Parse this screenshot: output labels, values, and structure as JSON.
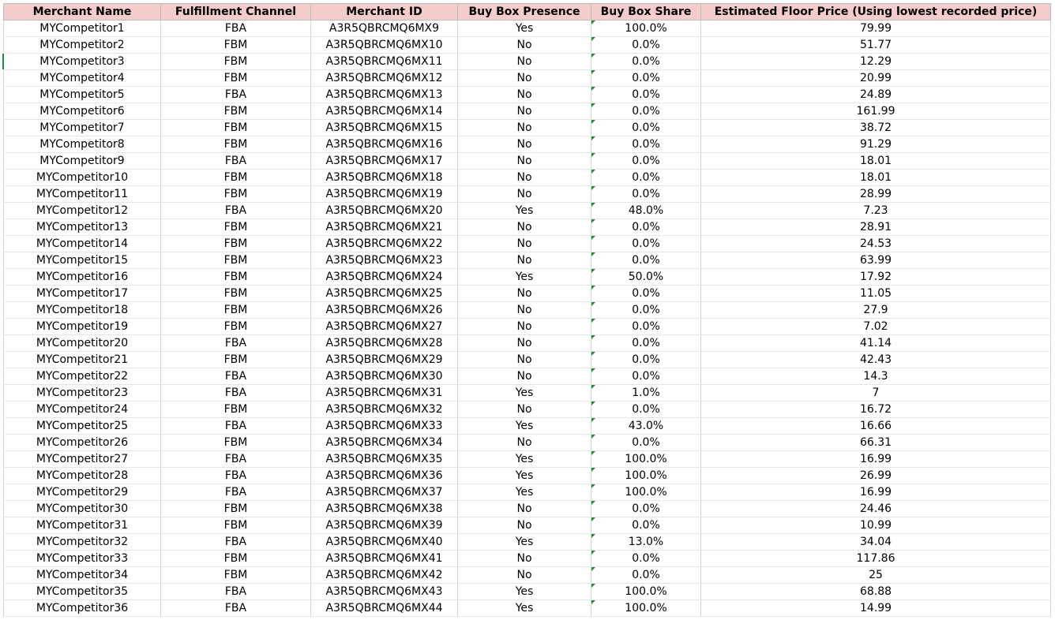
{
  "sheet": {
    "columns": [
      "Merchant Name",
      "Fulfillment Channel",
      "Merchant ID",
      "Buy Box Presence",
      "Buy Box Share",
      "Estimated Floor Price (Using lowest recorded price)"
    ],
    "colors": {
      "header_bg": "#f4cccc",
      "text_note_marker": "#1e8e3e"
    },
    "rows": [
      [
        "MYCompetitor1",
        "FBA",
        "A3R5QBRCMQ6MX9",
        "Yes",
        "100.0%",
        "79.99"
      ],
      [
        "MYCompetitor2",
        "FBM",
        "A3R5QBRCMQ6MX10",
        "No",
        "0.0%",
        "51.77"
      ],
      [
        "MYCompetitor3",
        "FBM",
        "A3R5QBRCMQ6MX11",
        "No",
        "0.0%",
        "12.29"
      ],
      [
        "MYCompetitor4",
        "FBM",
        "A3R5QBRCMQ6MX12",
        "No",
        "0.0%",
        "20.99"
      ],
      [
        "MYCompetitor5",
        "FBA",
        "A3R5QBRCMQ6MX13",
        "No",
        "0.0%",
        "24.89"
      ],
      [
        "MYCompetitor6",
        "FBM",
        "A3R5QBRCMQ6MX14",
        "No",
        "0.0%",
        "161.99"
      ],
      [
        "MYCompetitor7",
        "FBM",
        "A3R5QBRCMQ6MX15",
        "No",
        "0.0%",
        "38.72"
      ],
      [
        "MYCompetitor8",
        "FBM",
        "A3R5QBRCMQ6MX16",
        "No",
        "0.0%",
        "91.29"
      ],
      [
        "MYCompetitor9",
        "FBA",
        "A3R5QBRCMQ6MX17",
        "No",
        "0.0%",
        "18.01"
      ],
      [
        "MYCompetitor10",
        "FBM",
        "A3R5QBRCMQ6MX18",
        "No",
        "0.0%",
        "18.01"
      ],
      [
        "MYCompetitor11",
        "FBM",
        "A3R5QBRCMQ6MX19",
        "No",
        "0.0%",
        "28.99"
      ],
      [
        "MYCompetitor12",
        "FBA",
        "A3R5QBRCMQ6MX20",
        "Yes",
        "48.0%",
        "7.23"
      ],
      [
        "MYCompetitor13",
        "FBM",
        "A3R5QBRCMQ6MX21",
        "No",
        "0.0%",
        "28.91"
      ],
      [
        "MYCompetitor14",
        "FBM",
        "A3R5QBRCMQ6MX22",
        "No",
        "0.0%",
        "24.53"
      ],
      [
        "MYCompetitor15",
        "FBM",
        "A3R5QBRCMQ6MX23",
        "No",
        "0.0%",
        "63.99"
      ],
      [
        "MYCompetitor16",
        "FBM",
        "A3R5QBRCMQ6MX24",
        "Yes",
        "50.0%",
        "17.92"
      ],
      [
        "MYCompetitor17",
        "FBM",
        "A3R5QBRCMQ6MX25",
        "No",
        "0.0%",
        "11.05"
      ],
      [
        "MYCompetitor18",
        "FBM",
        "A3R5QBRCMQ6MX26",
        "No",
        "0.0%",
        "27.9"
      ],
      [
        "MYCompetitor19",
        "FBM",
        "A3R5QBRCMQ6MX27",
        "No",
        "0.0%",
        "7.02"
      ],
      [
        "MYCompetitor20",
        "FBA",
        "A3R5QBRCMQ6MX28",
        "No",
        "0.0%",
        "41.14"
      ],
      [
        "MYCompetitor21",
        "FBM",
        "A3R5QBRCMQ6MX29",
        "No",
        "0.0%",
        "42.43"
      ],
      [
        "MYCompetitor22",
        "FBA",
        "A3R5QBRCMQ6MX30",
        "No",
        "0.0%",
        "14.3"
      ],
      [
        "MYCompetitor23",
        "FBA",
        "A3R5QBRCMQ6MX31",
        "Yes",
        "1.0%",
        "7"
      ],
      [
        "MYCompetitor24",
        "FBM",
        "A3R5QBRCMQ6MX32",
        "No",
        "0.0%",
        "16.72"
      ],
      [
        "MYCompetitor25",
        "FBA",
        "A3R5QBRCMQ6MX33",
        "Yes",
        "43.0%",
        "16.66"
      ],
      [
        "MYCompetitor26",
        "FBM",
        "A3R5QBRCMQ6MX34",
        "No",
        "0.0%",
        "66.31"
      ],
      [
        "MYCompetitor27",
        "FBA",
        "A3R5QBRCMQ6MX35",
        "Yes",
        "100.0%",
        "16.99"
      ],
      [
        "MYCompetitor28",
        "FBA",
        "A3R5QBRCMQ6MX36",
        "Yes",
        "100.0%",
        "26.99"
      ],
      [
        "MYCompetitor29",
        "FBA",
        "A3R5QBRCMQ6MX37",
        "Yes",
        "100.0%",
        "16.99"
      ],
      [
        "MYCompetitor30",
        "FBM",
        "A3R5QBRCMQ6MX38",
        "No",
        "0.0%",
        "24.46"
      ],
      [
        "MYCompetitor31",
        "FBM",
        "A3R5QBRCMQ6MX39",
        "No",
        "0.0%",
        "10.99"
      ],
      [
        "MYCompetitor32",
        "FBA",
        "A3R5QBRCMQ6MX40",
        "Yes",
        "13.0%",
        "34.04"
      ],
      [
        "MYCompetitor33",
        "FBM",
        "A3R5QBRCMQ6MX41",
        "No",
        "0.0%",
        "117.86"
      ],
      [
        "MYCompetitor34",
        "FBM",
        "A3R5QBRCMQ6MX42",
        "No",
        "0.0%",
        "25"
      ],
      [
        "MYCompetitor35",
        "FBA",
        "A3R5QBRCMQ6MX43",
        "Yes",
        "100.0%",
        "68.88"
      ],
      [
        "MYCompetitor36",
        "FBA",
        "A3R5QBRCMQ6MX44",
        "Yes",
        "100.0%",
        "14.99"
      ]
    ]
  }
}
